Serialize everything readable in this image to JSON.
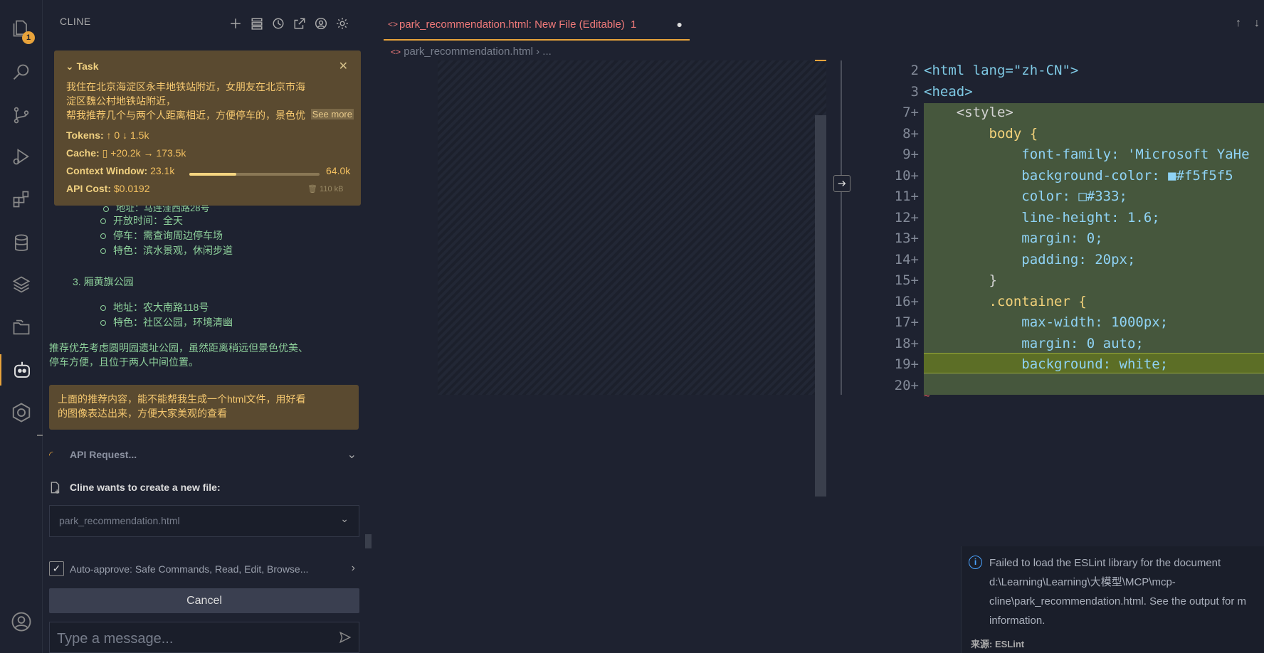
{
  "activity_bar": {
    "explorer_badge": "1",
    "items": [
      "explorer-icon",
      "search-icon",
      "source-control-icon",
      "run-debug-icon",
      "extensions-icon",
      "database-icon",
      "layers-icon",
      "folder-icon",
      "cline-icon",
      "remote-icon",
      "account-icon"
    ]
  },
  "sidebar": {
    "header": "CLINE",
    "task": {
      "title": "Task",
      "text_line1": "我住在北京海淀区永丰地铁站附近，女朋友在北京市海",
      "text_line2": "淀区魏公村地铁站附近，",
      "text_line3": "帮我推荐几个与两个人距离相近，方便停车的，景色优",
      "see_more": "See more",
      "tokens_label": "Tokens:",
      "tokens_value": "↑ 0  ↓ 1.5k",
      "cache_label": "Cache:",
      "cache_value": "+20.2k → 173.5k",
      "context_label": "Context Window:",
      "context_used": "23.1k",
      "context_max": "64.0k",
      "context_fraction": 0.36,
      "cost_label": "API Cost:",
      "cost_value": "$0.0192",
      "size": "110 kB"
    },
    "chat": {
      "partial_line": "地址：马连洼西路28号",
      "item2_hours": "开放时间：全天",
      "item2_parking": "停车：需查询周边停车场",
      "item2_feature": "特色：滨水景观，休闲步道",
      "item3_title": "3. 厢黄旗公园",
      "item3_address": "地址：农大南路118号",
      "item3_feature": "特色：社区公园，环境清幽",
      "summary1": "推荐优先考虑圆明园遗址公园，虽然距离稍远但景色优美、",
      "summary2": "停车方便，且位于两人中间位置。"
    },
    "user_message": {
      "line1": "上面的推荐内容，能不能帮我生成一个html文件，用好看",
      "line2": "的图像表达出来，方便大家美观的查看"
    },
    "api_request": "API Request...",
    "create_file_label": "Cline wants to create a new file:",
    "file_dropdown": "park_recommendation.html",
    "auto_approve": "Auto-approve: Safe Commands, Read, Edit, Browse...",
    "cancel": "Cancel",
    "input_placeholder": "Type a message..."
  },
  "editor": {
    "tab_title": "park_recommendation.html: New File (Editable)",
    "tab_errors": "1",
    "breadcrumb_file": "park_recommendation.html",
    "breadcrumb_more": "...",
    "lines": [
      {
        "n": "2",
        "code": "<html lang=\"zh-CN\">"
      },
      {
        "n": "3",
        "code": "<head>"
      },
      {
        "n": "7+",
        "code": "    <style>"
      },
      {
        "n": "8+",
        "code": "        body {"
      },
      {
        "n": "9+",
        "code": "            font-family: 'Microsoft YaHe"
      },
      {
        "n": "10+",
        "code": "            background-color: ■#f5f5f5"
      },
      {
        "n": "11+",
        "code": "            color: □#333;"
      },
      {
        "n": "12+",
        "code": "            line-height: 1.6;"
      },
      {
        "n": "13+",
        "code": "            margin: 0;"
      },
      {
        "n": "14+",
        "code": "            padding: 20px;"
      },
      {
        "n": "15+",
        "code": "        }"
      },
      {
        "n": "16+",
        "code": "        .container {"
      },
      {
        "n": "17+",
        "code": "            max-width: 1000px;"
      },
      {
        "n": "18+",
        "code": "            margin: 0 auto;"
      },
      {
        "n": "19+",
        "code": "            background: white;"
      },
      {
        "n": "20+",
        "code": ""
      }
    ]
  },
  "notification": {
    "line1": "Failed to load the ESLint library for the document",
    "line2": "d:\\Learning\\Learning\\大模型\\MCP\\mcp-",
    "line3": "cline\\park_recommendation.html. See the output for m",
    "line4": "information.",
    "source": "来源: ESLint"
  }
}
